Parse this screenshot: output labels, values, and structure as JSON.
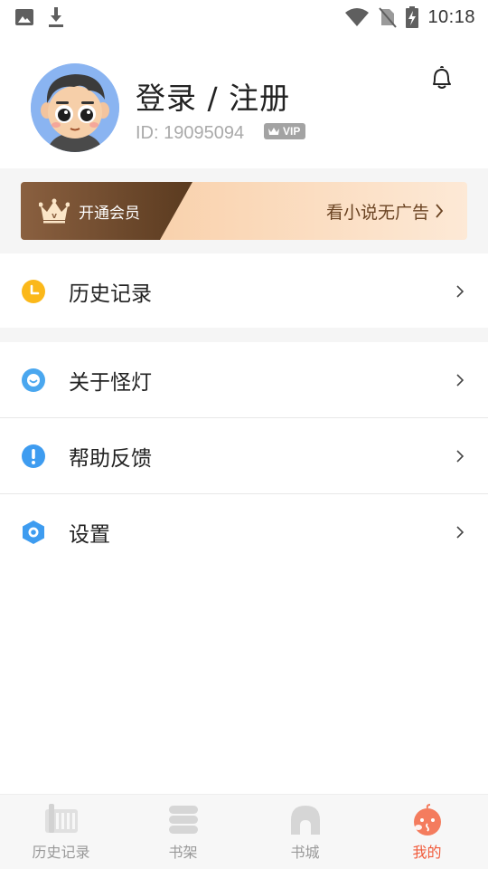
{
  "status_bar": {
    "time": "10:18",
    "icons": [
      "image-icon",
      "download-icon",
      "wifi-icon",
      "no-sim-icon",
      "battery-charging-icon"
    ]
  },
  "profile": {
    "title": "登录 / 注册",
    "user_id": "ID: 19095094",
    "vip_badge": "VIP",
    "avatar_icon": "cartoon-avatar",
    "bell_icon": "bell-icon"
  },
  "member_banner": {
    "label": "开通会员",
    "slogan": "看小说无广告",
    "colors": {
      "dark": "#7a5233",
      "light": "#fbd9b8"
    }
  },
  "menu": {
    "items": [
      {
        "label": "历史记录",
        "icon": "clock-icon",
        "color": "#fbb81a"
      },
      {
        "label": "关于怪灯",
        "icon": "smile-icon",
        "color": "#4aa7ef"
      },
      {
        "label": "帮助反馈",
        "icon": "exclamation-icon",
        "color": "#3e9cf0"
      },
      {
        "label": "设置",
        "icon": "hexagon-gear-icon",
        "color": "#3e9cf0"
      }
    ]
  },
  "bottom_nav": {
    "items": [
      {
        "label": "历史记录",
        "icon": "history-icon",
        "active": false
      },
      {
        "label": "书架",
        "icon": "bookshelf-icon",
        "active": false
      },
      {
        "label": "书城",
        "icon": "bookstore-icon",
        "active": false
      },
      {
        "label": "我的",
        "icon": "mine-icon",
        "active": true
      }
    ],
    "active_color": "#f15b3b",
    "inactive_color": "#999999"
  }
}
